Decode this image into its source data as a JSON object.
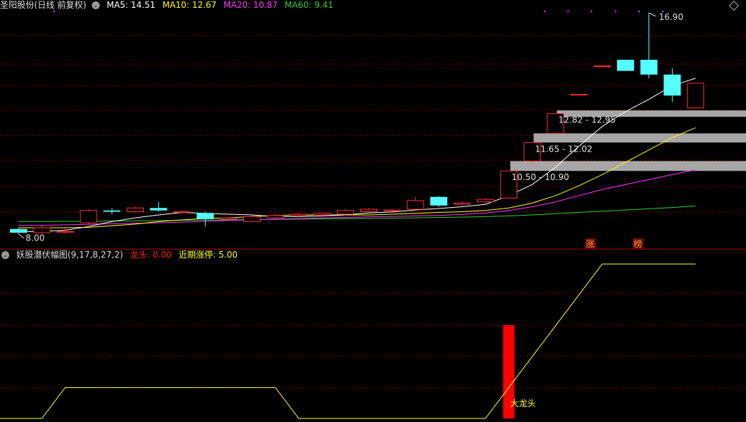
{
  "main_header": {
    "stock_title": "圣阳股份(日线 前复权)",
    "ma5": {
      "label": "MA5:",
      "value": "14.51",
      "color": "#ffffff"
    },
    "ma10": {
      "label": "MA10:",
      "value": "12.67",
      "color": "#ffff00"
    },
    "ma20": {
      "label": "MA20:",
      "value": "10.87",
      "color": "#ff33ff"
    },
    "ma60": {
      "label": "MA60:",
      "value": "9.41",
      "color": "#33cc33"
    }
  },
  "price_annotations": {
    "high_label": "16.90",
    "low_label": "8.00",
    "gaps": [
      "12.82 - 12.95",
      "11.65 - 12.02",
      "10.50 - 10.90"
    ]
  },
  "badges": [
    "涨",
    "榜"
  ],
  "indicator_header": {
    "name": "妖股潜伏幅图",
    "params": "(9,17,8,27,2)",
    "dragon_head": {
      "label": "龙头:",
      "value": "0.00",
      "color": "#ff2020"
    },
    "recent_limit_up": {
      "label": "近期涨停:",
      "value": "5.00",
      "color": "#ffff33"
    }
  },
  "signal_label": "大龙头",
  "colors": {
    "up": "#ff3030",
    "down": "#55ffff",
    "grid": "#8b0000",
    "bar": "#ff0000"
  },
  "chart_data": {
    "type": "candlestick",
    "candles": [
      {
        "o": 8.15,
        "c": 8.0,
        "h": 8.2,
        "l": 7.95
      },
      {
        "o": 8.0,
        "c": 8.2,
        "h": 8.3,
        "l": 7.95
      },
      {
        "o": 8.05,
        "c": 8.05,
        "h": 8.2,
        "l": 7.95
      },
      {
        "o": 8.4,
        "c": 8.9,
        "h": 8.95,
        "l": 8.35
      },
      {
        "o": 8.9,
        "c": 8.85,
        "h": 9.0,
        "l": 8.75
      },
      {
        "o": 8.85,
        "c": 9.0,
        "h": 9.05,
        "l": 8.8
      },
      {
        "o": 9.0,
        "c": 8.9,
        "h": 9.25,
        "l": 8.85
      },
      {
        "o": 8.82,
        "c": 8.85,
        "h": 8.9,
        "l": 8.78
      },
      {
        "o": 8.8,
        "c": 8.55,
        "h": 8.85,
        "l": 8.25
      },
      {
        "o": 8.55,
        "c": 8.6,
        "h": 8.65,
        "l": 8.5
      },
      {
        "o": 8.45,
        "c": 8.65,
        "h": 8.7,
        "l": 8.42
      },
      {
        "o": 8.6,
        "c": 8.7,
        "h": 8.75,
        "l": 8.55
      },
      {
        "o": 8.7,
        "c": 8.75,
        "h": 8.8,
        "l": 8.62
      },
      {
        "o": 8.72,
        "c": 8.78,
        "h": 8.82,
        "l": 8.65
      },
      {
        "o": 8.75,
        "c": 8.9,
        "h": 8.95,
        "l": 8.7
      },
      {
        "o": 8.85,
        "c": 8.95,
        "h": 9.0,
        "l": 8.8
      },
      {
        "o": 8.88,
        "c": 8.92,
        "h": 8.98,
        "l": 8.85
      },
      {
        "o": 8.95,
        "c": 9.3,
        "h": 9.45,
        "l": 8.95
      },
      {
        "o": 9.45,
        "c": 9.1,
        "h": 9.48,
        "l": 9.05
      },
      {
        "o": 9.15,
        "c": 9.2,
        "h": 9.25,
        "l": 9.1
      },
      {
        "o": 9.25,
        "c": 9.35,
        "h": 9.4,
        "l": 9.2
      },
      {
        "o": 9.4,
        "c": 10.5,
        "h": 10.5,
        "l": 9.4
      },
      {
        "o": 10.9,
        "c": 11.65,
        "h": 11.65,
        "l": 10.85
      },
      {
        "o": 12.02,
        "c": 12.82,
        "h": 12.82,
        "l": 12.02
      },
      {
        "o": 13.6,
        "c": 13.6,
        "h": 13.6,
        "l": 13.6
      },
      {
        "o": 14.75,
        "c": 14.75,
        "h": 14.75,
        "l": 14.75
      },
      {
        "o": 15.0,
        "c": 14.55,
        "h": 15.0,
        "l": 14.55
      },
      {
        "o": 15.0,
        "c": 14.4,
        "h": 16.9,
        "l": 14.25
      },
      {
        "o": 14.4,
        "c": 13.55,
        "h": 14.65,
        "l": 13.3
      },
      {
        "o": 13.05,
        "c": 14.05,
        "h": 14.05,
        "l": 13.05
      }
    ],
    "ma5": [
      8.05,
      8.05,
      8.1,
      8.25,
      8.45,
      8.6,
      8.72,
      8.82,
      8.78,
      8.75,
      8.72,
      8.65,
      8.65,
      8.68,
      8.72,
      8.8,
      8.84,
      8.92,
      8.98,
      9.05,
      9.15,
      9.5,
      9.95,
      10.65,
      11.5,
      12.3,
      12.9,
      13.4,
      13.95,
      14.25
    ],
    "ma10": [
      8.2,
      8.2,
      8.2,
      8.22,
      8.28,
      8.35,
      8.45,
      8.52,
      8.58,
      8.6,
      8.65,
      8.7,
      8.72,
      8.72,
      8.72,
      8.72,
      8.75,
      8.78,
      8.82,
      8.85,
      8.9,
      9.0,
      9.2,
      9.5,
      9.9,
      10.35,
      10.85,
      11.35,
      11.85,
      12.25
    ],
    "ma20": [
      8.3,
      8.3,
      8.32,
      8.34,
      8.36,
      8.38,
      8.4,
      8.43,
      8.46,
      8.5,
      8.52,
      8.55,
      8.57,
      8.6,
      8.62,
      8.64,
      8.66,
      8.68,
      8.7,
      8.74,
      8.8,
      8.9,
      9.05,
      9.25,
      9.5,
      9.75,
      9.95,
      10.15,
      10.35,
      10.55
    ],
    "ma60": [
      8.45,
      8.45,
      8.46,
      8.46,
      8.47,
      8.48,
      8.49,
      8.5,
      8.51,
      8.52,
      8.53,
      8.54,
      8.55,
      8.56,
      8.57,
      8.58,
      8.59,
      8.6,
      8.62,
      8.63,
      8.65,
      8.68,
      8.72,
      8.77,
      8.82,
      8.87,
      8.92,
      8.97,
      9.02,
      9.08
    ],
    "indicator_line": [
      0,
      0,
      1,
      1,
      1,
      1,
      1,
      1,
      1,
      1,
      1,
      1,
      0,
      0,
      0,
      0,
      0,
      0,
      0,
      0,
      0,
      1,
      2,
      3,
      4,
      5,
      5,
      5,
      5,
      5
    ],
    "signal_index": 21,
    "indicator_ylim": [
      0,
      5
    ]
  }
}
